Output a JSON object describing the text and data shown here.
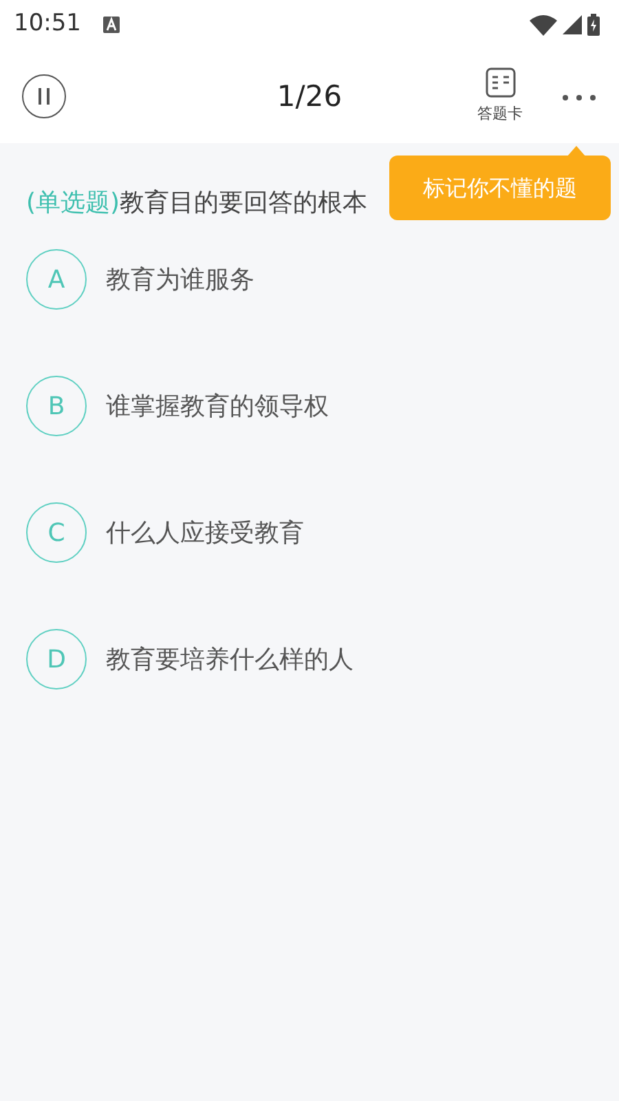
{
  "status_bar": {
    "time": "10:51"
  },
  "header": {
    "progress": "1/26",
    "answer_card_label": "答题卡"
  },
  "question": {
    "type_tag": "(单选题)",
    "text": "教育目的要回答的根本"
  },
  "tooltip": {
    "text": "标记你不懂的题"
  },
  "options": [
    {
      "letter": "A",
      "text": "教育为谁服务",
      "selected": false
    },
    {
      "letter": "B",
      "text": "谁掌握教育的领导权",
      "selected": false
    },
    {
      "letter": "C",
      "text": "什么人应接受教育",
      "selected": false
    },
    {
      "letter": "D",
      "text": "教育要培养什么样的人",
      "selected": false
    }
  ]
}
